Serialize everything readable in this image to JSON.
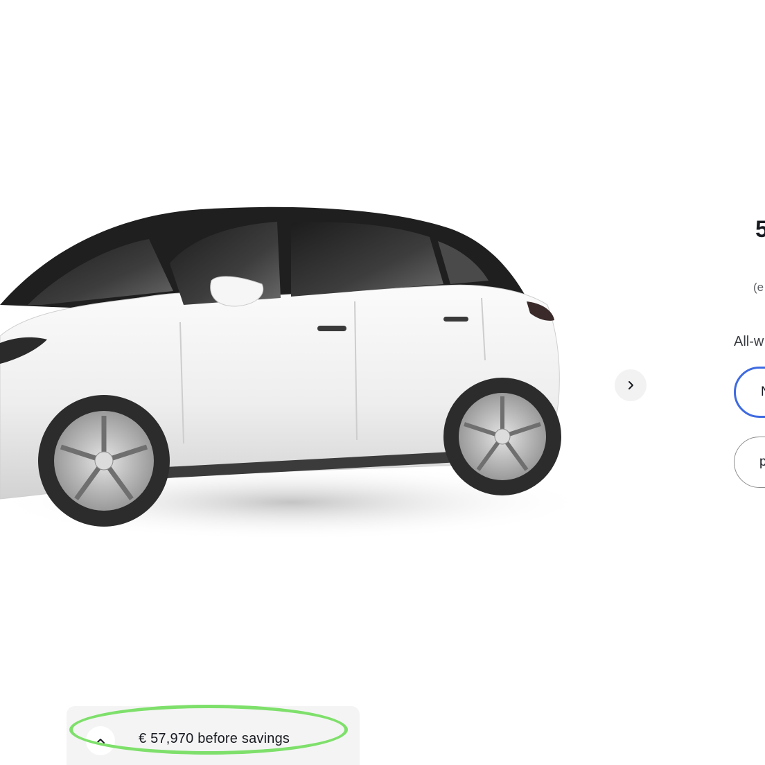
{
  "gallery": {
    "image_alt": "White Model Y side-front view",
    "next_icon": "chevron-right-icon"
  },
  "panel": {
    "price_partial": "5",
    "note_partial": "(e",
    "drivetrain_heading_partial": "All-w",
    "options": [
      {
        "label_partial": "N",
        "selected": true
      },
      {
        "label_partial": "p",
        "selected": false
      }
    ],
    "accent_color": "#3e6ae1"
  },
  "price_bar": {
    "expand_icon": "chevron-up-icon",
    "summary": "€ 57,970 before savings",
    "highlight_color": "#7ee06b"
  }
}
